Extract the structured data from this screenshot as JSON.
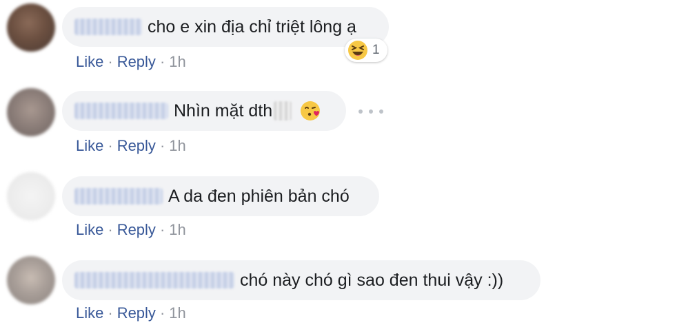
{
  "comments": [
    {
      "text": "cho e xin địa chỉ triệt lông ạ",
      "actions": {
        "like": "Like",
        "reply": "Reply",
        "time": "1h"
      },
      "reaction": {
        "icon": "haha-icon",
        "count": "1"
      }
    },
    {
      "text": "Nhìn mặt dth",
      "emoji": "kissing-heart-emoji",
      "actions": {
        "like": "Like",
        "reply": "Reply",
        "time": "1h"
      }
    },
    {
      "text": "A da đen phiên bản chó",
      "actions": {
        "like": "Like",
        "reply": "Reply",
        "time": "1h"
      }
    },
    {
      "text": "chó này chó gì sao đen thui vậy :))",
      "actions": {
        "like": "Like",
        "reply": "Reply",
        "time": "1h"
      }
    }
  ],
  "separator": "·",
  "colors": {
    "bubble": "#f2f3f5",
    "link": "#385898",
    "meta": "#90949c",
    "text": "#1c1e21"
  }
}
